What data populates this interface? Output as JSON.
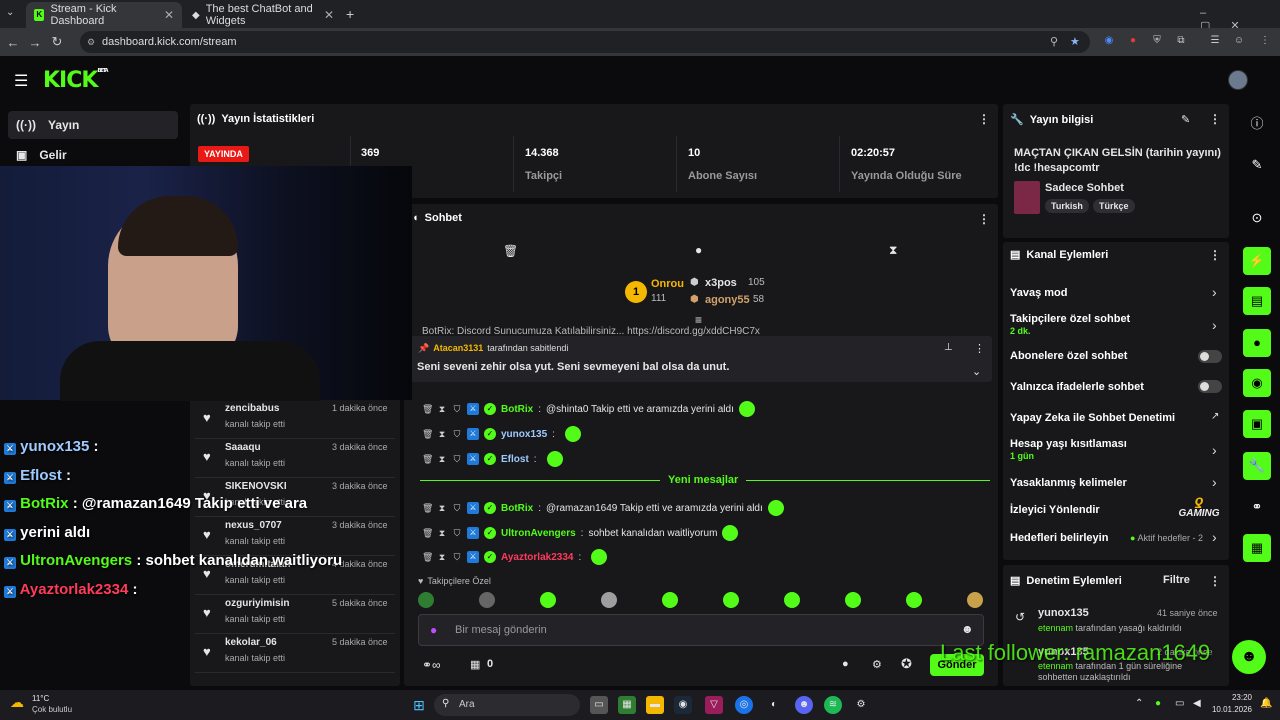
{
  "browser": {
    "tabs": [
      {
        "label": "Stream - Kick Dashboard"
      },
      {
        "label": "The best ChatBot and Widgets"
      }
    ],
    "url": "dashboard.kick.com/stream"
  },
  "header": {
    "logo": "KICK",
    "beta": "BETA"
  },
  "sidebar": {
    "items": [
      {
        "label": "Yayın",
        "icon": "broadcast-icon"
      },
      {
        "label": "Gelir",
        "icon": "revenue-icon"
      }
    ]
  },
  "stats": {
    "title": "Yayın İstatistikleri",
    "live_badge": "YAYINDA",
    "viewers": "369",
    "followers_value": "14.368",
    "followers_label": "Takipçi",
    "subs_value": "10",
    "subs_label": "Abone Sayısı",
    "duration_value": "02:20:57",
    "duration_label": "Yayında Olduğu Süre"
  },
  "chat": {
    "title": "Sohbet",
    "leaderboard": {
      "first_rank": "1",
      "first_name": "Onrou",
      "first_points": "111",
      "second_name": "x3pos",
      "second_points": "105",
      "third_name": "agony55",
      "third_points": "58"
    },
    "hidden_line": "BotRix: Discord Sunucumuza Katılabilirsiniz... https://discord.gg/xddCH9C7x",
    "pinned": {
      "by": "Atacan3131",
      "by_suffix": "tarafından sabitlendi",
      "text": "Seni seveni zehir olsa yut. Seni sevmeyeni bal olsa da unut."
    },
    "messages": [
      {
        "user": "BotRix",
        "color": "#53fc18",
        "text": "@shinta0 Takip etti ve aramızda yerini aldı"
      },
      {
        "user": "yunox135",
        "color": "#9ecbff",
        "text": ""
      },
      {
        "user": "Eflost",
        "color": "#9ecbff",
        "text": ""
      }
    ],
    "new_messages_label": "Yeni mesajlar",
    "new_messages": [
      {
        "user": "BotRix",
        "color": "#53fc18",
        "text": "@ramazan1649 Takip etti ve aramızda yerini aldı"
      },
      {
        "user": "UltronAvengers",
        "color": "#53fc18",
        "text": "sohbet kanalıdan waitliyorum"
      },
      {
        "user": "Ayaztorlak2334",
        "color": "#ff3b5c",
        "text": ""
      }
    ],
    "emote_section": "Takipçilere Özel",
    "input_placeholder": "Bir mesaj gönderin",
    "points": "0",
    "send_label": "Gönder"
  },
  "followers_list": [
    {
      "name": "zencibabus",
      "sub": "kanalı takip etti",
      "time": "1 dakika önce"
    },
    {
      "name": "Saaaqu",
      "sub": "kanalı takip etti",
      "time": "3 dakika önce"
    },
    {
      "name": "SIKENOVSKI",
      "sub": "kanalı takip etti",
      "time": "3 dakika önce"
    },
    {
      "name": "nexus_0707",
      "sub": "kanalı takip etti",
      "time": "3 dakika önce"
    },
    {
      "name": "omerumitalan",
      "sub": "kanalı takip etti",
      "time": "4 dakika önce"
    },
    {
      "name": "ozguriyimisin",
      "sub": "kanalı takip etti",
      "time": "5 dakika önce"
    },
    {
      "name": "kekolar_06",
      "sub": "kanalı takip etti",
      "time": "5 dakika önce"
    }
  ],
  "overlay_chat": [
    {
      "user": "yunox135",
      "color": "#9ecbff",
      "text": ":"
    },
    {
      "user": "Eflost",
      "color": "#9ecbff",
      "text": ":"
    },
    {
      "user": "BotRix",
      "color": "#53fc18",
      "text": ": @ramazan1649 Takip etti ve ara"
    },
    {
      "user": "",
      "color": "#ffffff",
      "text": "yerini aldı"
    },
    {
      "user": "UltronAvengers",
      "color": "#53fc18",
      "text": ": sohbet kanalıdan waitliyoru"
    },
    {
      "user": "Ayaztorlak2334",
      "color": "#ff3b5c",
      "text": ":"
    }
  ],
  "stream_info": {
    "title": "Yayın bilgisi",
    "stream_title": "MAÇTAN ÇIKAN GELSİN (tarihin yayını) !dc !hesapcomtr",
    "category": "Sadece Sohbet",
    "tags": [
      "Turkish",
      "Türkçe"
    ]
  },
  "channel_actions": {
    "title": "Kanal Eylemleri",
    "slow_mode": "Yavaş mod",
    "followers_only": "Takipçilere özel sohbet",
    "followers_only_value": "2 dk.",
    "subs_only": "Abonelere özel sohbet",
    "emotes_only": "Yalnızca ifadelerle sohbet",
    "ai_moderation": "Yapay Zeka ile Sohbet Denetimi",
    "age_restriction": "Hesap yaşı kısıtlaması",
    "age_restriction_value": "1 gün",
    "banned_words": "Yasaklanmış kelimeler",
    "viewer_redirect": "İzleyici Yönlendir",
    "goals": "Hedefleri belirleyin",
    "goals_status": "Aktif hedefler - 2"
  },
  "moderation": {
    "title": "Denetim Eylemleri",
    "filter": "Filtre",
    "items": [
      {
        "user": "yunox135",
        "time": "41 saniye önce",
        "actor": "etennam",
        "text": "tarafından yasağı kaldırıldı"
      },
      {
        "user": "yunox135",
        "time": "2 dakika önce",
        "actor": "etennam",
        "text": "tarafından 1 gün süreliğine sohbetten uzaklaştırıldı"
      }
    ]
  },
  "overlays": {
    "last_follower": "Last follower: ramazan1649",
    "gaming_logo": "GAMING"
  },
  "taskbar": {
    "weather_temp": "11°C",
    "weather_desc": "Çok bulutlu",
    "search": "Ara",
    "time": "23:20",
    "date": "10.01.2026"
  },
  "colors": {
    "accent": "#53fc18",
    "live": "#e91916",
    "panel": "#18181b",
    "background": "#0b0b0d"
  }
}
